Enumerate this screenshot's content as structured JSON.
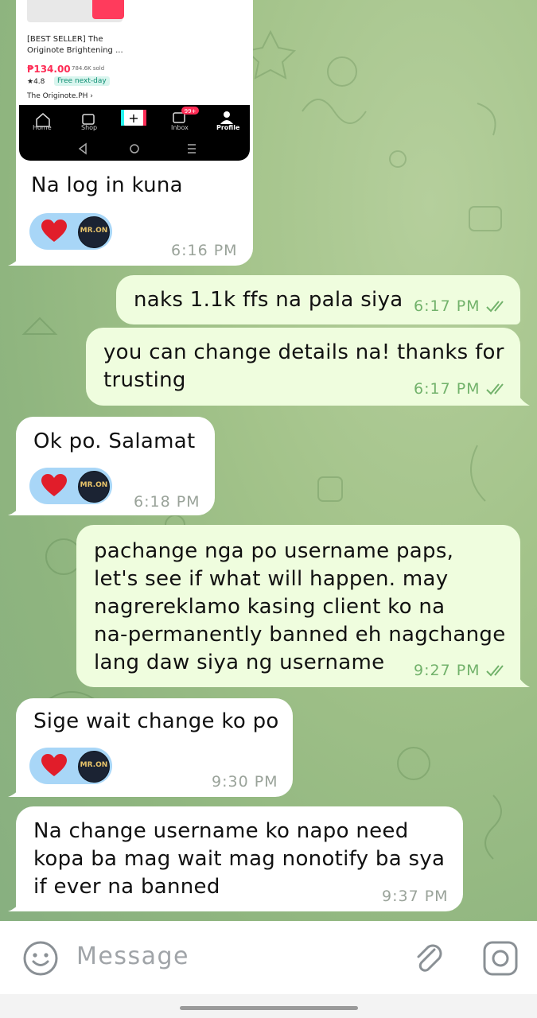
{
  "colors": {
    "incoming_bubble": "#ffffff",
    "outgoing_bubble": "#effdde",
    "reaction_pill": "#a8d6f7",
    "read_checks": "#72b26b"
  },
  "embedded_screenshot": {
    "product_title_line1": "[BEST SELLER] The",
    "product_title_line2": "Originote Brightening ...",
    "price": "₱134.00",
    "sold": "784.6K sold",
    "rating": "★4.8",
    "shipping": "Free next-day",
    "shop": "The Originote.PH ›",
    "nav": [
      "Home",
      "Shop",
      "+",
      "Inbox",
      "Profile"
    ],
    "inbox_badge": "99+"
  },
  "messages": [
    {
      "dir": "in",
      "text": "Na log in kuna",
      "time": "6:16 PM",
      "reaction": "heart-icon"
    },
    {
      "dir": "out",
      "text": "naks 1.1k ffs na pala siya",
      "time": "6:17 PM"
    },
    {
      "dir": "out",
      "text": "you can change details na! thanks for\ntrusting",
      "time": "6:17 PM"
    },
    {
      "dir": "in",
      "text": "Ok po. Salamat",
      "time": "6:18 PM",
      "reaction": "heart-icon"
    },
    {
      "dir": "out",
      "text": "pachange nga po username paps,\nlet's see if what will happen. may\nnagrereklamo kasing client ko na\nna-permanently banned eh nagchange\nlang daw siya ng username",
      "time": "9:27 PM"
    },
    {
      "dir": "in",
      "text": "Sige wait change ko po",
      "time": "9:30 PM",
      "reaction": "heart-icon"
    },
    {
      "dir": "in",
      "text": "Na change username ko napo need\nkopa ba mag wait mag nonotify ba sya\nif ever na banned",
      "time": "9:37 PM"
    }
  ],
  "avatar_label": "MR.ON",
  "composer": {
    "placeholder": "Message"
  }
}
